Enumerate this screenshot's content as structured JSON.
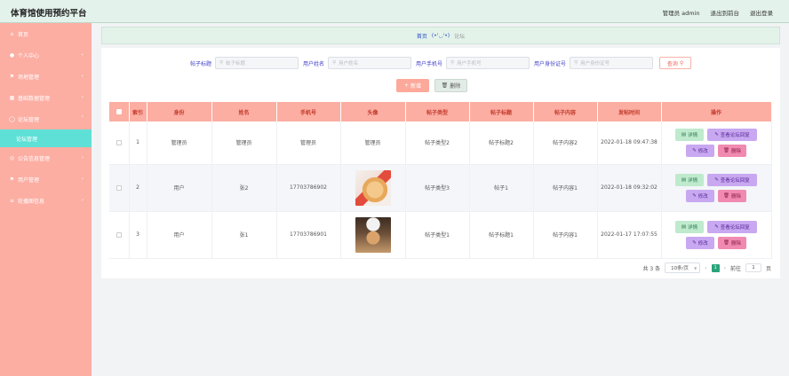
{
  "app": {
    "title": "体育馆使用预约平台"
  },
  "topbar": {
    "user": "管理员 admin",
    "front": "退出到前台",
    "logout": "退出登录"
  },
  "sidebar": {
    "items": [
      {
        "label": "首页",
        "icon": "home-icon"
      },
      {
        "label": "个人中心",
        "icon": "user-icon"
      },
      {
        "label": "场地管理",
        "icon": "flag-icon"
      },
      {
        "label": "基础数据管理",
        "icon": "grid-icon"
      },
      {
        "label": "论坛管理",
        "icon": "chat-icon"
      },
      {
        "label": "论坛管理",
        "icon": "sub"
      },
      {
        "label": "公告信息管理",
        "icon": "bell-icon"
      },
      {
        "label": "用户管理",
        "icon": "flag-icon"
      },
      {
        "label": "轮播图信息",
        "icon": "list-icon"
      }
    ]
  },
  "breadcrumb": {
    "home": "首页",
    "sep": "(•'◡'•)",
    "current": "论坛"
  },
  "search": {
    "fields": [
      {
        "label": "帖子标题",
        "placeholder": "帖子标题"
      },
      {
        "label": "用户姓名",
        "placeholder": "用户姓名"
      },
      {
        "label": "用户手机号",
        "placeholder": "用户手机号"
      },
      {
        "label": "用户身份证号",
        "placeholder": "用户身份证号"
      }
    ],
    "query_label": "查询"
  },
  "actions": {
    "add": "新增",
    "delete": "删除"
  },
  "table": {
    "headers": [
      "索引",
      "身份",
      "姓名",
      "手机号",
      "头像",
      "帖子类型",
      "帖子标题",
      "帖子内容",
      "发帖时间",
      "操作"
    ],
    "rows": [
      {
        "index": "1",
        "identity": "管理员",
        "name": "管理员",
        "phone": "管理员",
        "avatar": "管理员",
        "type": "帖子类型2",
        "title": "帖子标题2",
        "content": "帖子内容2",
        "time": "2022-01-18 09:47:38"
      },
      {
        "index": "2",
        "identity": "用户",
        "name": "张2",
        "phone": "17703786902",
        "avatar": "",
        "type": "帖子类型3",
        "title": "帖子1",
        "content": "帖子内容1",
        "time": "2022-01-18 09:32:02"
      },
      {
        "index": "3",
        "identity": "用户",
        "name": "张1",
        "phone": "17703786901",
        "avatar": "",
        "type": "帖子类型1",
        "title": "帖子标题1",
        "content": "帖子内容1",
        "time": "2022-01-17 17:07:55"
      }
    ],
    "ops": {
      "detail": "详情",
      "reply": "查看论坛回复",
      "edit": "修改",
      "delete": "删除"
    }
  },
  "pagination": {
    "total": "共 3 条",
    "page_size": "10条/页",
    "current": "1",
    "goto_prefix": "前往",
    "goto_value": "1",
    "goto_suffix": "页"
  },
  "colors": {
    "sidebar": "#fcaea3",
    "active_sub": "#5fe0d6",
    "header_bg": "#e4f2ec",
    "accent": "#2aa37a"
  }
}
